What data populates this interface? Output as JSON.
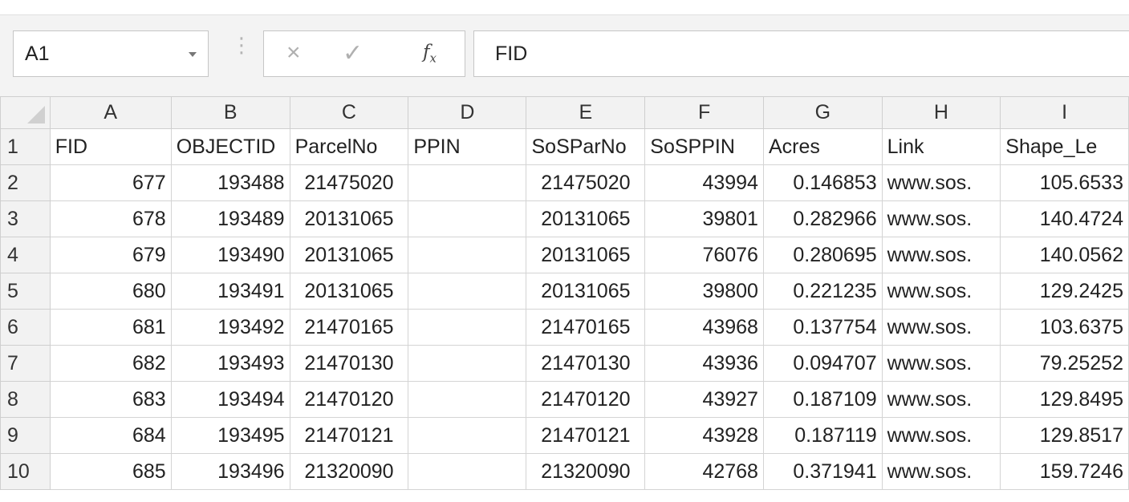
{
  "name_box": {
    "value": "A1"
  },
  "formula_bar": {
    "separator": "⋮",
    "cancel_icon": "×",
    "enter_icon": "✓",
    "fx_label": "fx",
    "content": "FID"
  },
  "columns": [
    "A",
    "B",
    "C",
    "D",
    "E",
    "F",
    "G",
    "H",
    "I"
  ],
  "header_row": {
    "num": "1",
    "cells": [
      "FID",
      "OBJECTID",
      "ParcelNo",
      "PPIN",
      "SoSParNo",
      "SoSPPIN",
      "Acres",
      "Link",
      "Shape_Le"
    ]
  },
  "rows": [
    {
      "num": "2",
      "cells": [
        "677",
        "193488",
        "21475020",
        "",
        "21475020",
        "43994",
        "0.146853",
        "www.sos.",
        "105.6533"
      ]
    },
    {
      "num": "3",
      "cells": [
        "678",
        "193489",
        "20131065",
        "",
        "20131065",
        "39801",
        "0.282966",
        "www.sos.",
        "140.4724"
      ]
    },
    {
      "num": "4",
      "cells": [
        "679",
        "193490",
        "20131065",
        "",
        "20131065",
        "76076",
        "0.280695",
        "www.sos.",
        "140.0562"
      ]
    },
    {
      "num": "5",
      "cells": [
        "680",
        "193491",
        "20131065",
        "",
        "20131065",
        "39800",
        "0.221235",
        "www.sos.",
        "129.2425"
      ]
    },
    {
      "num": "6",
      "cells": [
        "681",
        "193492",
        "21470165",
        "",
        "21470165",
        "43968",
        "0.137754",
        "www.sos.",
        "103.6375"
      ]
    },
    {
      "num": "7",
      "cells": [
        "682",
        "193493",
        "21470130",
        "",
        "21470130",
        "43936",
        "0.094707",
        "www.sos.",
        "79.25252"
      ]
    },
    {
      "num": "8",
      "cells": [
        "683",
        "193494",
        "21470120",
        "",
        "21470120",
        "43927",
        "0.187109",
        "www.sos.",
        "129.8495"
      ]
    },
    {
      "num": "9",
      "cells": [
        "684",
        "193495",
        "21470121",
        "",
        "21470121",
        "43928",
        "0.187119",
        "www.sos.",
        "129.8517"
      ]
    },
    {
      "num": "10",
      "cells": [
        "685",
        "193496",
        "21320090",
        "",
        "21320090",
        "42768",
        "0.371941",
        "www.sos.",
        "159.7246"
      ]
    }
  ]
}
